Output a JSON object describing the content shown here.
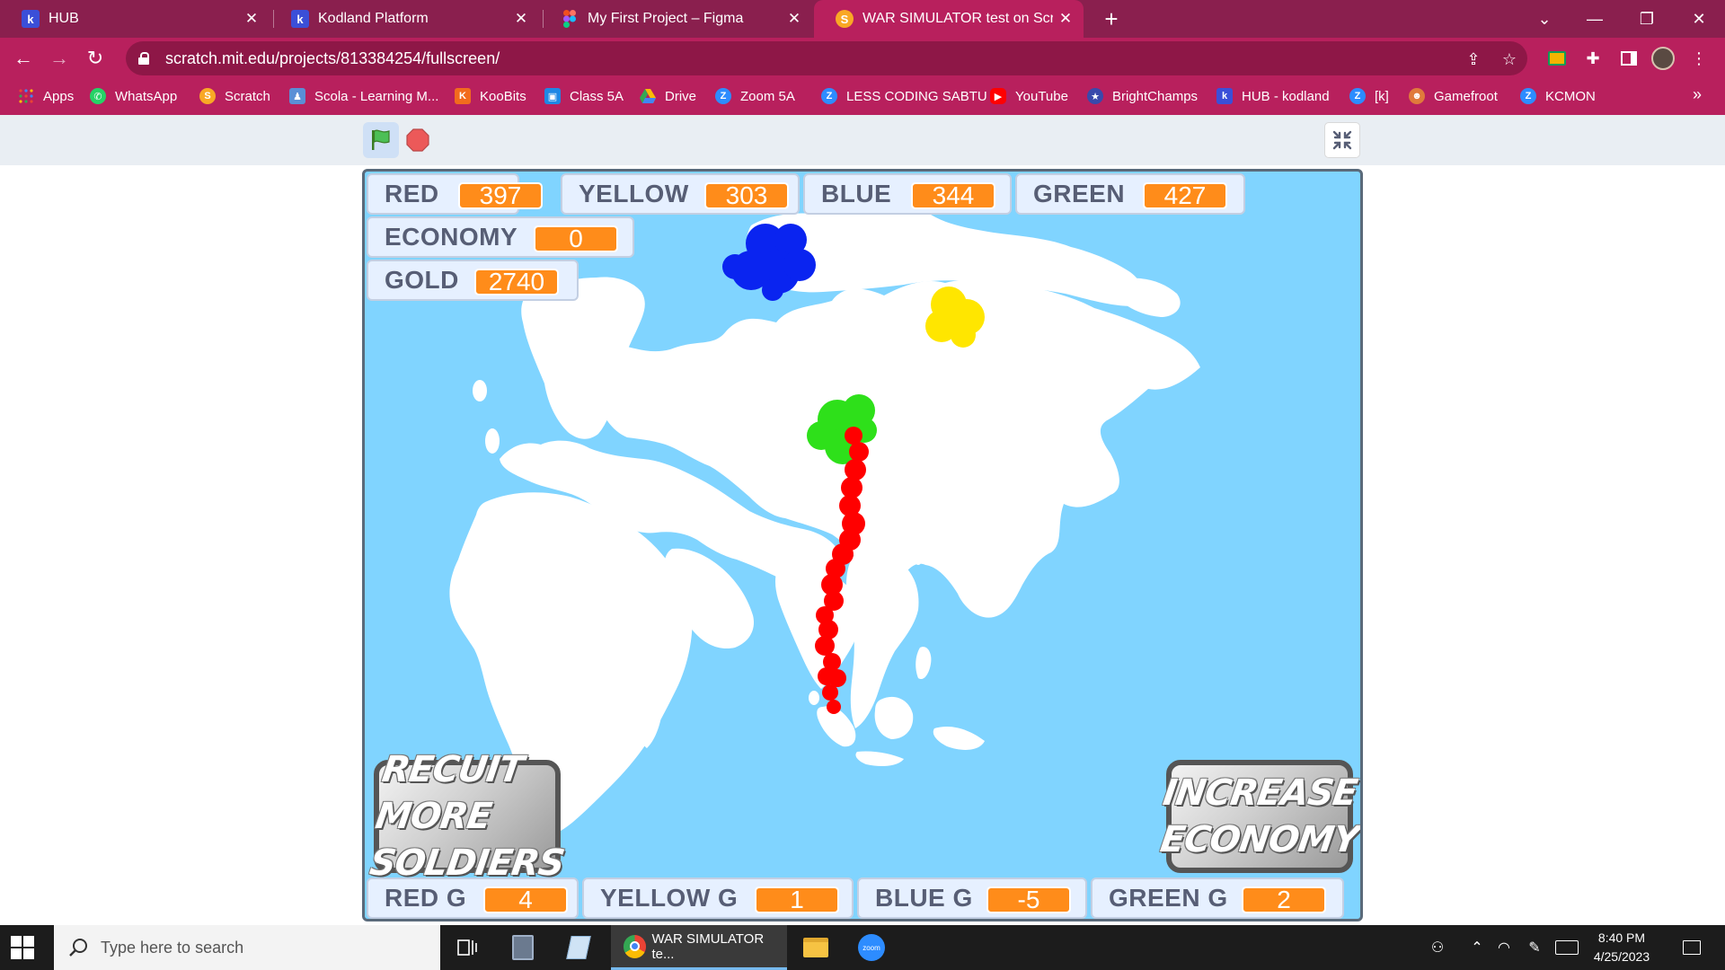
{
  "browser": {
    "tabs": [
      {
        "title": "HUB",
        "favicon": "k-icon",
        "active": false
      },
      {
        "title": "Kodland Platform",
        "favicon": "k-icon",
        "active": false
      },
      {
        "title": "My First Project – Figma",
        "favicon": "figma-icon",
        "active": false
      },
      {
        "title": "WAR SIMULATOR test on Scratch",
        "favicon": "scratch-icon",
        "active": true
      }
    ],
    "url": "scratch.mit.edu/projects/813384254/fullscreen/",
    "accent_color": "#b8205d",
    "bookmarks": [
      {
        "label": "Apps",
        "icon": "apps-grid-icon"
      },
      {
        "label": "WhatsApp",
        "icon": "whatsapp-icon"
      },
      {
        "label": "Scratch",
        "icon": "scratch-icon"
      },
      {
        "label": "Scola - Learning M...",
        "icon": "scola-icon"
      },
      {
        "label": "KooBits",
        "icon": "koobits-icon"
      },
      {
        "label": "Class 5A",
        "icon": "classroom-icon"
      },
      {
        "label": "Drive",
        "icon": "drive-icon"
      },
      {
        "label": "Zoom 5A",
        "icon": "zoom-icon"
      },
      {
        "label": "LESS CODING SABTU",
        "icon": "zoom-icon"
      },
      {
        "label": "YouTube",
        "icon": "youtube-icon"
      },
      {
        "label": "BrightChamps",
        "icon": "brightchamps-icon"
      },
      {
        "label": "HUB - kodland",
        "icon": "k-icon"
      },
      {
        "label": "[k]",
        "icon": "zoom-icon"
      },
      {
        "label": "Gamefroot",
        "icon": "gamefroot-icon"
      },
      {
        "label": "KCMON",
        "icon": "zoom-icon"
      }
    ],
    "more_bookmarks": "»"
  },
  "game": {
    "monitors": {
      "red": {
        "label": "RED",
        "value": "397"
      },
      "yellow": {
        "label": "YELLOW",
        "value": "303"
      },
      "blue": {
        "label": "BLUE",
        "value": "344"
      },
      "green": {
        "label": "GREEN",
        "value": "427"
      },
      "economy": {
        "label": "ECONOMY",
        "value": "0"
      },
      "gold": {
        "label": "GOLD",
        "value": "2740"
      },
      "red_g": {
        "label": "RED G",
        "value": "4"
      },
      "yellow_g": {
        "label": "YELLOW G",
        "value": "1"
      },
      "blue_g": {
        "label": "BLUE G",
        "value": "-5"
      },
      "green_g": {
        "label": "GREEN G",
        "value": "2"
      }
    },
    "buttons": {
      "recruit_line1": "RECUIT MORE",
      "recruit_line2": "SOLDIERS",
      "economy_line1": "INCREASE",
      "economy_line2": "ECONOMY"
    },
    "colors": {
      "ocean": "#80d4ff",
      "land": "#ffffff",
      "red_army": "#ff0000",
      "yellow_army": "#ffe600",
      "blue_army": "#0a24f0",
      "green_army": "#2ee01a",
      "monitor_value": "#ff8c1a"
    }
  },
  "taskbar": {
    "search_placeholder": "Type here to search",
    "active_app_label": "WAR SIMULATOR te...",
    "time": "8:40 PM",
    "date": "4/25/2023"
  }
}
